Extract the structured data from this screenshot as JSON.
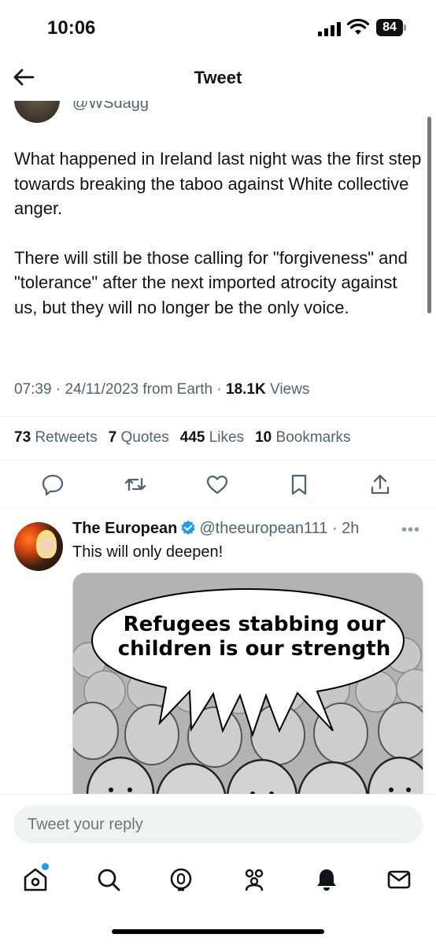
{
  "status_bar": {
    "time": "10:06",
    "battery": "84"
  },
  "nav": {
    "title": "Tweet"
  },
  "author": {
    "handle": "@WSdagg"
  },
  "tweet": {
    "paragraphs": [
      "What happened in Ireland last night was the first step towards breaking the taboo against White collective anger.",
      "There will still be those calling for \"forgiveness\" and \"tolerance\" after the next imported atrocity against us, but they will no longer be the only voice."
    ],
    "time": "07:39",
    "date": "24/11/2023",
    "source": "from Earth",
    "views_count": "18.1K",
    "views_label": "Views"
  },
  "stats": {
    "retweets_count": "73",
    "retweets_label": "Retweets",
    "quotes_count": "7",
    "quotes_label": "Quotes",
    "likes_count": "445",
    "likes_label": "Likes",
    "bookmarks_count": "10",
    "bookmarks_label": "Bookmarks"
  },
  "actions": [
    "reply-icon",
    "retweet-icon",
    "like-icon",
    "bookmark-icon",
    "share-icon"
  ],
  "reply": {
    "name": "The European",
    "handle": "@theeuropean111",
    "time": "2h",
    "text": "This will only deepen!",
    "meme_caption": "Refugees stabbing our children is our strength"
  },
  "reply_input": {
    "placeholder": "Tweet your reply"
  },
  "tabbar": [
    "home-icon",
    "search-icon",
    "spaces-icon",
    "communities-icon",
    "notifications-icon",
    "messages-icon"
  ],
  "colors": {
    "accent": "#1d9bf0",
    "text": "#0f1419",
    "secondary": "#536471"
  }
}
